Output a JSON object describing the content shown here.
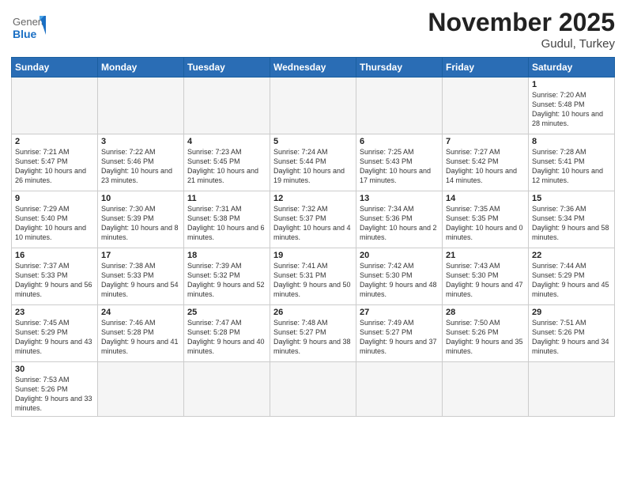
{
  "header": {
    "logo_general": "General",
    "logo_blue": "Blue",
    "title": "November 2025",
    "subtitle": "Gudul, Turkey"
  },
  "days_of_week": [
    "Sunday",
    "Monday",
    "Tuesday",
    "Wednesday",
    "Thursday",
    "Friday",
    "Saturday"
  ],
  "weeks": [
    [
      {
        "day": "",
        "info": ""
      },
      {
        "day": "",
        "info": ""
      },
      {
        "day": "",
        "info": ""
      },
      {
        "day": "",
        "info": ""
      },
      {
        "day": "",
        "info": ""
      },
      {
        "day": "",
        "info": ""
      },
      {
        "day": "1",
        "info": "Sunrise: 7:20 AM\nSunset: 5:48 PM\nDaylight: 10 hours\nand 28 minutes."
      }
    ],
    [
      {
        "day": "2",
        "info": "Sunrise: 7:21 AM\nSunset: 5:47 PM\nDaylight: 10 hours\nand 26 minutes."
      },
      {
        "day": "3",
        "info": "Sunrise: 7:22 AM\nSunset: 5:46 PM\nDaylight: 10 hours\nand 23 minutes."
      },
      {
        "day": "4",
        "info": "Sunrise: 7:23 AM\nSunset: 5:45 PM\nDaylight: 10 hours\nand 21 minutes."
      },
      {
        "day": "5",
        "info": "Sunrise: 7:24 AM\nSunset: 5:44 PM\nDaylight: 10 hours\nand 19 minutes."
      },
      {
        "day": "6",
        "info": "Sunrise: 7:25 AM\nSunset: 5:43 PM\nDaylight: 10 hours\nand 17 minutes."
      },
      {
        "day": "7",
        "info": "Sunrise: 7:27 AM\nSunset: 5:42 PM\nDaylight: 10 hours\nand 14 minutes."
      },
      {
        "day": "8",
        "info": "Sunrise: 7:28 AM\nSunset: 5:41 PM\nDaylight: 10 hours\nand 12 minutes."
      }
    ],
    [
      {
        "day": "9",
        "info": "Sunrise: 7:29 AM\nSunset: 5:40 PM\nDaylight: 10 hours\nand 10 minutes."
      },
      {
        "day": "10",
        "info": "Sunrise: 7:30 AM\nSunset: 5:39 PM\nDaylight: 10 hours\nand 8 minutes."
      },
      {
        "day": "11",
        "info": "Sunrise: 7:31 AM\nSunset: 5:38 PM\nDaylight: 10 hours\nand 6 minutes."
      },
      {
        "day": "12",
        "info": "Sunrise: 7:32 AM\nSunset: 5:37 PM\nDaylight: 10 hours\nand 4 minutes."
      },
      {
        "day": "13",
        "info": "Sunrise: 7:34 AM\nSunset: 5:36 PM\nDaylight: 10 hours\nand 2 minutes."
      },
      {
        "day": "14",
        "info": "Sunrise: 7:35 AM\nSunset: 5:35 PM\nDaylight: 10 hours\nand 0 minutes."
      },
      {
        "day": "15",
        "info": "Sunrise: 7:36 AM\nSunset: 5:34 PM\nDaylight: 9 hours\nand 58 minutes."
      }
    ],
    [
      {
        "day": "16",
        "info": "Sunrise: 7:37 AM\nSunset: 5:33 PM\nDaylight: 9 hours\nand 56 minutes."
      },
      {
        "day": "17",
        "info": "Sunrise: 7:38 AM\nSunset: 5:33 PM\nDaylight: 9 hours\nand 54 minutes."
      },
      {
        "day": "18",
        "info": "Sunrise: 7:39 AM\nSunset: 5:32 PM\nDaylight: 9 hours\nand 52 minutes."
      },
      {
        "day": "19",
        "info": "Sunrise: 7:41 AM\nSunset: 5:31 PM\nDaylight: 9 hours\nand 50 minutes."
      },
      {
        "day": "20",
        "info": "Sunrise: 7:42 AM\nSunset: 5:30 PM\nDaylight: 9 hours\nand 48 minutes."
      },
      {
        "day": "21",
        "info": "Sunrise: 7:43 AM\nSunset: 5:30 PM\nDaylight: 9 hours\nand 47 minutes."
      },
      {
        "day": "22",
        "info": "Sunrise: 7:44 AM\nSunset: 5:29 PM\nDaylight: 9 hours\nand 45 minutes."
      }
    ],
    [
      {
        "day": "23",
        "info": "Sunrise: 7:45 AM\nSunset: 5:29 PM\nDaylight: 9 hours\nand 43 minutes."
      },
      {
        "day": "24",
        "info": "Sunrise: 7:46 AM\nSunset: 5:28 PM\nDaylight: 9 hours\nand 41 minutes."
      },
      {
        "day": "25",
        "info": "Sunrise: 7:47 AM\nSunset: 5:28 PM\nDaylight: 9 hours\nand 40 minutes."
      },
      {
        "day": "26",
        "info": "Sunrise: 7:48 AM\nSunset: 5:27 PM\nDaylight: 9 hours\nand 38 minutes."
      },
      {
        "day": "27",
        "info": "Sunrise: 7:49 AM\nSunset: 5:27 PM\nDaylight: 9 hours\nand 37 minutes."
      },
      {
        "day": "28",
        "info": "Sunrise: 7:50 AM\nSunset: 5:26 PM\nDaylight: 9 hours\nand 35 minutes."
      },
      {
        "day": "29",
        "info": "Sunrise: 7:51 AM\nSunset: 5:26 PM\nDaylight: 9 hours\nand 34 minutes."
      }
    ],
    [
      {
        "day": "30",
        "info": "Sunrise: 7:53 AM\nSunset: 5:26 PM\nDaylight: 9 hours\nand 33 minutes."
      },
      {
        "day": "",
        "info": ""
      },
      {
        "day": "",
        "info": ""
      },
      {
        "day": "",
        "info": ""
      },
      {
        "day": "",
        "info": ""
      },
      {
        "day": "",
        "info": ""
      },
      {
        "day": "",
        "info": ""
      }
    ]
  ]
}
